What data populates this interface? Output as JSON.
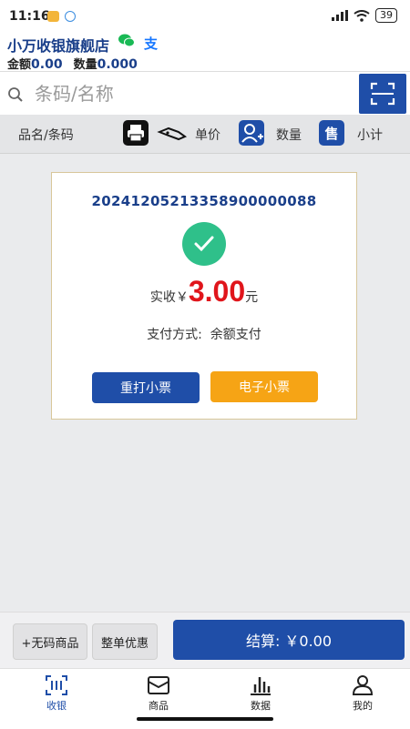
{
  "status_bar": {
    "time": "11:16",
    "battery": "39"
  },
  "header": {
    "store_name": "小万收银旗舰店",
    "amount_label": "金额",
    "amount_value": "0.00",
    "quantity_label": "数量",
    "quantity_value": "0.000",
    "alipay_glyph": "支"
  },
  "search": {
    "placeholder": "条码/名称"
  },
  "columns": {
    "name": "品名/条码",
    "price": "单价",
    "quantity": "数量",
    "sale_icon_text": "售",
    "subtotal": "小计"
  },
  "receipt": {
    "order_no": "20241205213358900000088",
    "paid_label": "实收￥",
    "paid_amount": "3.00",
    "paid_unit": "元",
    "pay_method": "支付方式:  余额支付",
    "reprint_label": "重打小票",
    "e_receipt_label": "电子小票"
  },
  "actions": {
    "no_code_label": "+无码商品",
    "discount_label": "整单优惠",
    "checkout_label": "结算: ￥0.00"
  },
  "tabs": [
    {
      "label": "收银",
      "icon": "cashier-icon",
      "active": true
    },
    {
      "label": "商品",
      "icon": "goods-icon",
      "active": false
    },
    {
      "label": "数据",
      "icon": "chart-icon",
      "active": false
    },
    {
      "label": "我的",
      "icon": "user-icon",
      "active": false
    }
  ],
  "colors": {
    "primary": "#1f4ea8",
    "accent_orange": "#f6a415",
    "amount_red": "#e0151b",
    "success_green": "#2fc08a"
  }
}
